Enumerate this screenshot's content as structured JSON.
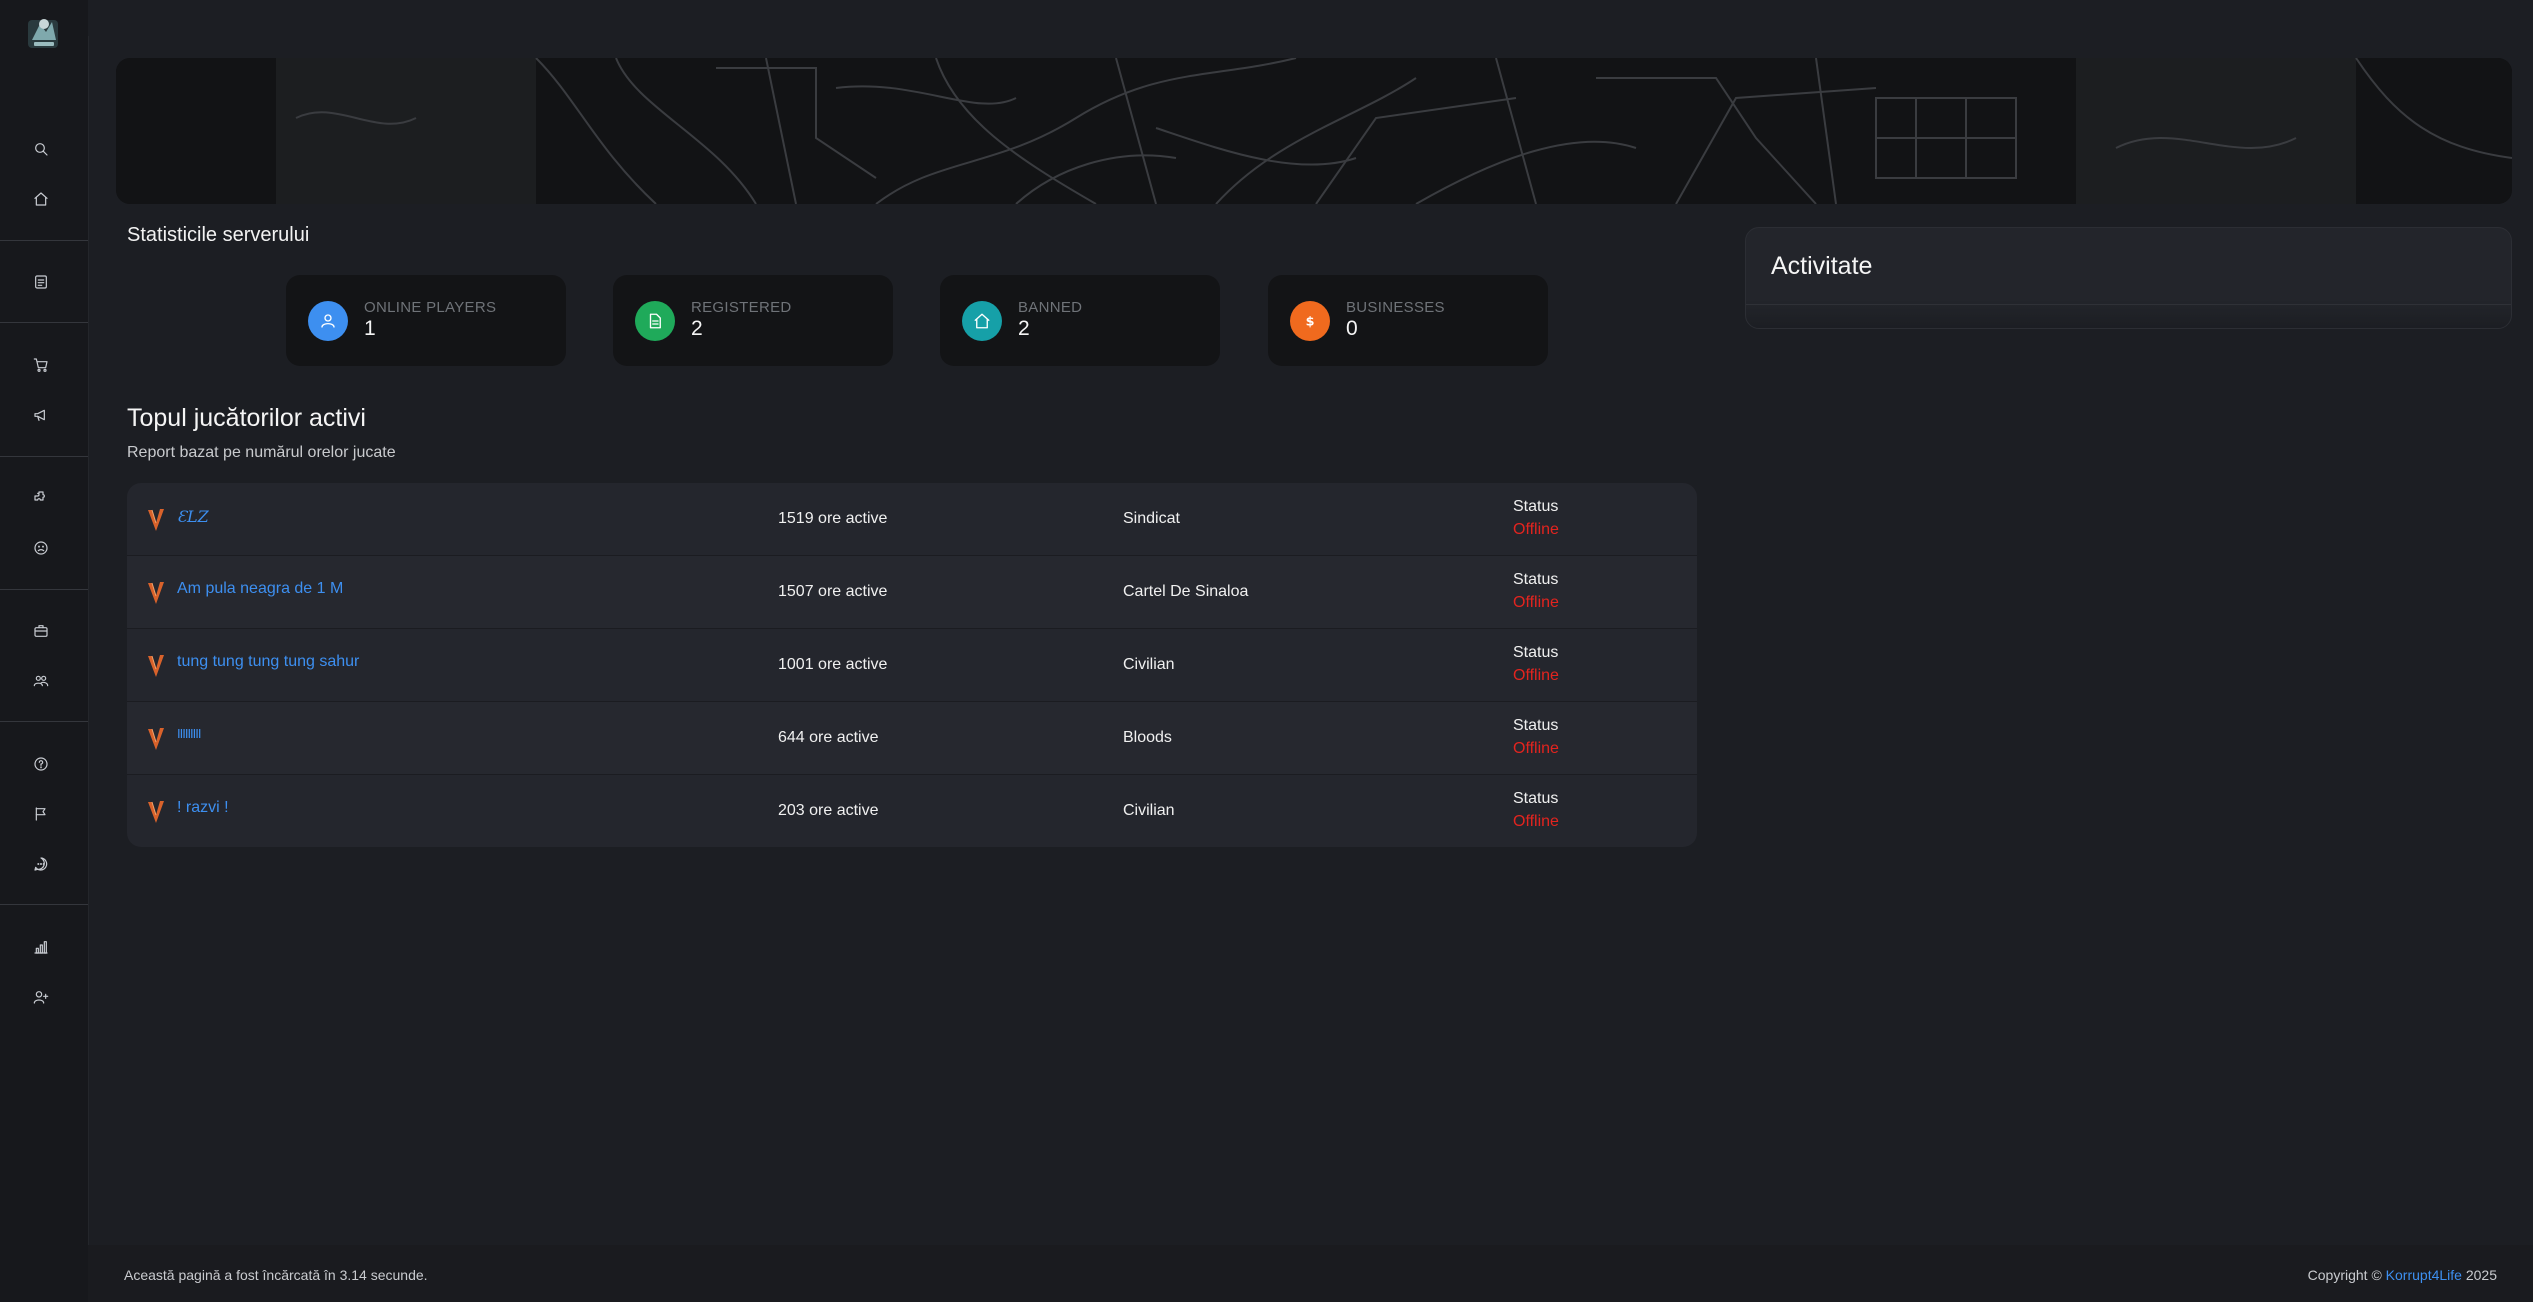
{
  "sidebar": {
    "icons": [
      "logo",
      "search-icon",
      "home-icon",
      "document-icon",
      "cart-icon",
      "megaphone-icon",
      "puzzle-icon",
      "sad-face-icon",
      "briefcase-icon",
      "users-icon",
      "help-icon",
      "flag-icon",
      "chat-icon",
      "chart-icon",
      "add-user-icon"
    ]
  },
  "stats": {
    "title": "Statisticile serverului",
    "cards": [
      {
        "label": "ONLINE PLAYERS",
        "value": "1",
        "color": "#3d8ff0",
        "icon": "user-icon"
      },
      {
        "label": "REGISTERED",
        "value": "2",
        "color": "#1faa5a",
        "icon": "document-icon"
      },
      {
        "label": "BANNED",
        "value": "2",
        "color": "#16a0a8",
        "icon": "home-icon"
      },
      {
        "label": "BUSINESSES",
        "value": "0",
        "color": "#f06a1e",
        "icon": "dollar-icon"
      }
    ]
  },
  "players": {
    "title": "Topul jucătorilor activi",
    "subtitle": "Report bazat pe numărul orelor jucate",
    "status_label": "Status",
    "rows": [
      {
        "name": "ƐLZ",
        "hours": "1519 ore active",
        "faction": "Sindicat",
        "status": "Offline"
      },
      {
        "name": "Am pula neagra de 1 M",
        "hours": "1507 ore active",
        "faction": "Cartel De Sinaloa",
        "status": "Offline"
      },
      {
        "name": "tung tung tung tung sahur",
        "hours": "1001 ore active",
        "faction": "Civilian",
        "status": "Offline"
      },
      {
        "name": "IIIIIIIII",
        "hours": "644 ore active",
        "faction": "Bloods",
        "status": "Offline"
      },
      {
        "name": "! razvi !",
        "hours": "203 ore active",
        "faction": "Civilian",
        "status": "Offline"
      }
    ]
  },
  "activity": {
    "title": "Activitate"
  },
  "footer": {
    "left": "Această pagină a fost încărcată în 3.14 secunde.",
    "copyright_prefix": "Copyright ©",
    "brand": "Korrupt4Life",
    "year": "2025"
  }
}
